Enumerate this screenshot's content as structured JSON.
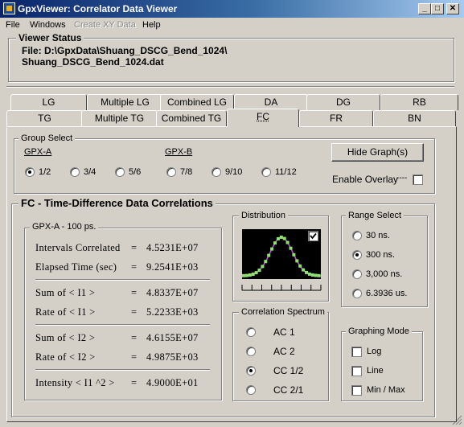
{
  "window": {
    "title": "GpxViewer: Correlator Data Viewer",
    "minimize": "_",
    "maximize": "□",
    "close": "✕"
  },
  "menu": {
    "file": "File",
    "windows": "Windows",
    "create_xy": "Create XY Data",
    "help": "Help"
  },
  "viewer_status": {
    "label": "Viewer  Status",
    "line1": "File: D:\\GpxData\\Shuang_DSCG_Bend_1024\\",
    "line2": "Shuang_DSCG_Bend_1024.dat"
  },
  "tabs": {
    "row1": [
      "LG",
      "Multiple LG",
      "Combined LG",
      "DA",
      "DG",
      "RB"
    ],
    "row2": [
      "TG",
      "Multiple TG",
      "Combined TG",
      "FC",
      "FR",
      "BN"
    ],
    "active": "FC"
  },
  "group_select": {
    "label": "Group Select",
    "gpxa_label": "GPX-A",
    "gpxb_label": "GPX-B",
    "options": [
      "1/2",
      "3/4",
      "5/6",
      "7/8",
      "9/10",
      "11/12"
    ],
    "selected": "1/2",
    "hide_button": "Hide Graph(s)",
    "overlay_label": "Enable Overlay",
    "overlay_line": "----",
    "overlay_checked": false
  },
  "fc_section": {
    "title": "FC - Time-Difference Data Correlations"
  },
  "gpxa_box": {
    "label": "GPX-A  - 100 ps.",
    "rows": [
      {
        "name": "Intervals Correlated",
        "eq": "=",
        "value": "4.5231E+07"
      },
      {
        "name": "Elapsed Time (sec)",
        "eq": "=",
        "value": "9.2541E+03"
      },
      {
        "name": "Sum of < I1 >",
        "eq": "=",
        "value": "4.8337E+07"
      },
      {
        "name": "Rate of < I1 >",
        "eq": "=",
        "value": "5.2233E+03"
      },
      {
        "name": "Sum of < I2 >",
        "eq": "=",
        "value": "4.6155E+07"
      },
      {
        "name": "Rate of < I2 >",
        "eq": "=",
        "value": "4.9875E+03"
      },
      {
        "name": "Intensity < I1 ^2 >",
        "eq": "=",
        "value": "4.9000E+01"
      }
    ]
  },
  "distribution": {
    "label": "Distribution",
    "checked": true,
    "bg": "#000000",
    "point_color": "#90e070",
    "fit_color": "#c050e0"
  },
  "range_select": {
    "label": "Range Select",
    "options": [
      "30 ns.",
      "300 ns.",
      "3,000 ns.",
      "6.3936 us."
    ],
    "selected": "300 ns."
  },
  "correlation_spectrum": {
    "label": "Correlation Spectrum",
    "options": [
      "AC  1",
      "AC  2",
      "CC  1/2",
      "CC  2/1"
    ],
    "selected": "CC  1/2"
  },
  "graphing_mode": {
    "label": "Graphing  Mode",
    "options": [
      {
        "label": "Log",
        "checked": false
      },
      {
        "label": "Line",
        "checked": false
      },
      {
        "label": "Min / Max",
        "checked": false
      }
    ]
  }
}
